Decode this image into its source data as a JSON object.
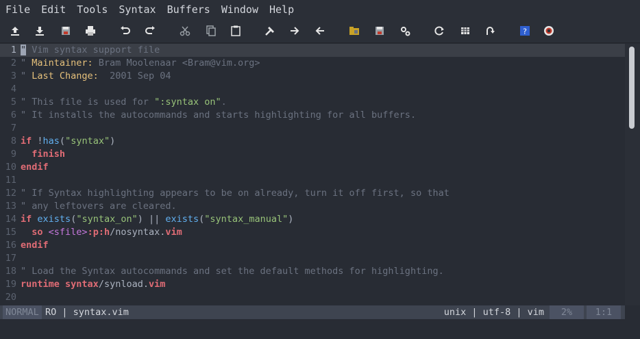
{
  "menu": [
    "File",
    "Edit",
    "Tools",
    "Syntax",
    "Buffers",
    "Window",
    "Help"
  ],
  "toolbar": [
    "open-icon",
    "save-download-icon",
    "save-icon",
    "print-icon",
    "undo-icon",
    "redo-icon",
    "cut-icon",
    "copy-icon",
    "paste-icon",
    "find-replace-icon",
    "find-next-icon",
    "find-prev-icon",
    "load-session-icon",
    "save-session-icon",
    "run-script-icon",
    "make-icon",
    "run-ctags-icon",
    "jump-tag-icon",
    "help-icon",
    "find-help-icon"
  ],
  "lines": [
    {
      "n": "1",
      "cur": true,
      "segs": [
        {
          "t": "\"",
          "c": "cursor"
        },
        {
          "t": " Vim syntax support file",
          "c": "c-comment"
        }
      ]
    },
    {
      "n": "2",
      "segs": [
        {
          "t": "\" ",
          "c": "c-comment"
        },
        {
          "t": "Maintainer:",
          "c": "c-maint"
        },
        {
          "t": " Bram Moolenaar <Bram@vim.org>",
          "c": "c-comment"
        }
      ]
    },
    {
      "n": "3",
      "segs": [
        {
          "t": "\" ",
          "c": "c-comment"
        },
        {
          "t": "Last Change:",
          "c": "c-maint"
        },
        {
          "t": "  2001 Sep 04",
          "c": "c-comment"
        }
      ]
    },
    {
      "n": "4",
      "segs": []
    },
    {
      "n": "5",
      "segs": [
        {
          "t": "\" This file is used for ",
          "c": "c-comment"
        },
        {
          "t": "\":syntax on\"",
          "c": "c-str"
        },
        {
          "t": ".",
          "c": "c-comment"
        }
      ]
    },
    {
      "n": "6",
      "segs": [
        {
          "t": "\" It installs the autocommands and starts highlighting for all buffers.",
          "c": "c-comment"
        }
      ]
    },
    {
      "n": "7",
      "segs": []
    },
    {
      "n": "8",
      "segs": [
        {
          "t": "if",
          "c": "c-kw"
        },
        {
          "t": " !",
          "c": "c-ident"
        },
        {
          "t": "has",
          "c": "c-fn"
        },
        {
          "t": "(",
          "c": "c-ident"
        },
        {
          "t": "\"syntax\"",
          "c": "c-str"
        },
        {
          "t": ")",
          "c": "c-ident"
        }
      ]
    },
    {
      "n": "9",
      "segs": [
        {
          "t": "  finish",
          "c": "c-kw"
        }
      ]
    },
    {
      "n": "10",
      "segs": [
        {
          "t": "endif",
          "c": "c-kw"
        }
      ]
    },
    {
      "n": "11",
      "segs": []
    },
    {
      "n": "12",
      "segs": [
        {
          "t": "\" If Syntax highlighting appears to be on already, turn it off first, so that",
          "c": "c-comment"
        }
      ]
    },
    {
      "n": "13",
      "segs": [
        {
          "t": "\" any leftovers are cleared.",
          "c": "c-comment"
        }
      ]
    },
    {
      "n": "14",
      "segs": [
        {
          "t": "if",
          "c": "c-kw"
        },
        {
          "t": " ",
          "c": "c-ident"
        },
        {
          "t": "exists",
          "c": "c-fn"
        },
        {
          "t": "(",
          "c": "c-ident"
        },
        {
          "t": "\"syntax_on\"",
          "c": "c-str"
        },
        {
          "t": ") || ",
          "c": "c-ident"
        },
        {
          "t": "exists",
          "c": "c-fn"
        },
        {
          "t": "(",
          "c": "c-ident"
        },
        {
          "t": "\"syntax_manual\"",
          "c": "c-str"
        },
        {
          "t": ")",
          "c": "c-ident"
        }
      ]
    },
    {
      "n": "15",
      "segs": [
        {
          "t": "  so",
          "c": "c-kw"
        },
        {
          "t": " ",
          "c": "c-ident"
        },
        {
          "t": "<sfile>",
          "c": "c-tag"
        },
        {
          "t": ":p:h",
          "c": "c-kw"
        },
        {
          "t": "/nosyntax.",
          "c": "c-ident"
        },
        {
          "t": "vim",
          "c": "c-kw"
        }
      ]
    },
    {
      "n": "16",
      "segs": [
        {
          "t": "endif",
          "c": "c-kw"
        }
      ]
    },
    {
      "n": "17",
      "segs": []
    },
    {
      "n": "18",
      "segs": [
        {
          "t": "\" Load the Syntax autocommands and set the default methods for highlighting.",
          "c": "c-comment"
        }
      ]
    },
    {
      "n": "19",
      "segs": [
        {
          "t": "runtime",
          "c": "c-kw"
        },
        {
          "t": " ",
          "c": "c-ident"
        },
        {
          "t": "syntax",
          "c": "c-kw"
        },
        {
          "t": "/synload.",
          "c": "c-ident"
        },
        {
          "t": "vim",
          "c": "c-kw"
        }
      ]
    },
    {
      "n": "20",
      "segs": []
    }
  ],
  "status": {
    "mode": "NORMAL",
    "file": "RO | syntax.vim",
    "right": "unix | utf-8 | vim",
    "percent": "2%",
    "position": "1:1"
  },
  "colors": {
    "background": "#282c34",
    "comment": "#6b7280",
    "keyword": "#e06c75",
    "function": "#61afef",
    "string": "#98c379"
  }
}
